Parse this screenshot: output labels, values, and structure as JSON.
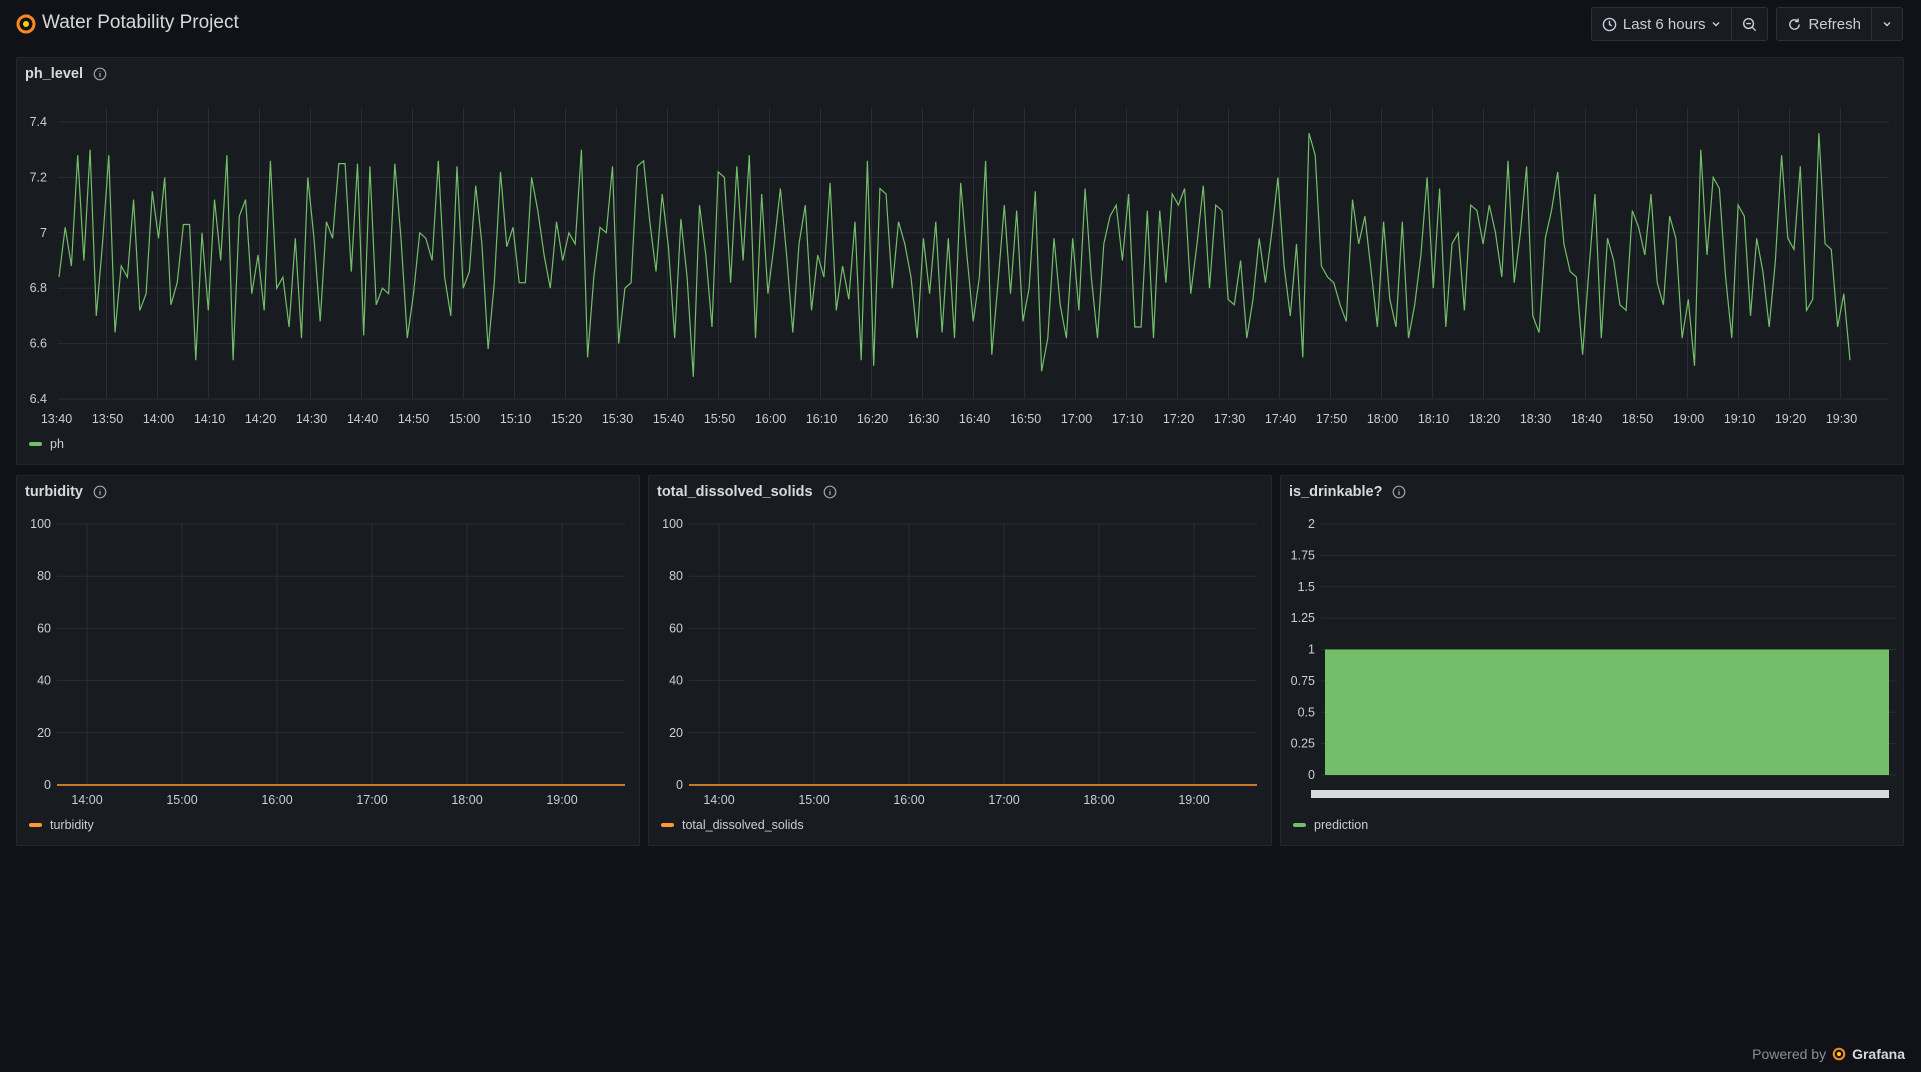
{
  "header": {
    "title": "Water Potability Project",
    "time_range": "Last 6 hours",
    "refresh_label": "Refresh"
  },
  "colors": {
    "green": "#73bf69",
    "orange": "#ff9830"
  },
  "panels": {
    "ph": {
      "title": "ph_level",
      "legend": "ph"
    },
    "turbidity": {
      "title": "turbidity",
      "legend": "turbidity"
    },
    "tds": {
      "title": "total_dissolved_solids",
      "legend": "total_dissolved_solids"
    },
    "drink": {
      "title": "is_drinkable?",
      "legend": "prediction"
    }
  },
  "footer": {
    "powered_by": "Powered by",
    "brand": "Grafana"
  },
  "chart_data": [
    {
      "type": "line",
      "title": "ph_level",
      "series": [
        {
          "name": "ph"
        }
      ],
      "x_ticks": [
        "13:40",
        "13:50",
        "14:00",
        "14:10",
        "14:20",
        "14:30",
        "14:40",
        "14:50",
        "15:00",
        "15:10",
        "15:20",
        "15:30",
        "15:40",
        "15:50",
        "16:00",
        "16:10",
        "16:20",
        "16:30",
        "16:40",
        "16:50",
        "17:00",
        "17:10",
        "17:20",
        "17:30",
        "17:40",
        "17:50",
        "18:00",
        "18:10",
        "18:20",
        "18:30",
        "18:40",
        "18:50",
        "19:00",
        "19:10",
        "19:20",
        "19:30"
      ],
      "y_ticks": [
        "6.4",
        "6.6",
        "6.8",
        "7",
        "7.2",
        "7.4"
      ],
      "ylim": [
        6.4,
        7.4
      ],
      "y": [
        6.84,
        7.02,
        6.88,
        7.28,
        6.9,
        7.3,
        6.7,
        6.96,
        7.28,
        6.64,
        6.88,
        6.84,
        7.12,
        6.72,
        6.78,
        7.15,
        6.98,
        7.2,
        6.74,
        6.82,
        7.03,
        7.03,
        6.54,
        7.0,
        6.72,
        7.12,
        6.9,
        7.28,
        6.54,
        7.06,
        7.12,
        6.78,
        6.92,
        6.72,
        7.26,
        6.8,
        6.84,
        6.66,
        6.98,
        6.62,
        7.2,
        6.98,
        6.68,
        7.04,
        6.98,
        7.25,
        7.25,
        6.86,
        7.25,
        6.63,
        7.24,
        6.74,
        6.8,
        6.78,
        7.25,
        6.98,
        6.62,
        6.78,
        7.0,
        6.98,
        6.9,
        7.26,
        6.84,
        6.7,
        7.24,
        6.8,
        6.86,
        7.17,
        6.96,
        6.58,
        6.82,
        7.22,
        6.95,
        7.02,
        6.82,
        6.82,
        7.2,
        7.08,
        6.92,
        6.8,
        7.04,
        6.9,
        7.0,
        6.96,
        7.3,
        6.55,
        6.84,
        7.02,
        7.0,
        7.24,
        6.6,
        6.8,
        6.82,
        7.24,
        7.26,
        7.04,
        6.86,
        7.14,
        6.95,
        6.62,
        7.05,
        6.84,
        6.48,
        7.1,
        6.92,
        6.66,
        7.22,
        7.2,
        6.82,
        7.24,
        6.9,
        7.28,
        6.62,
        7.14,
        6.78,
        6.96,
        7.16,
        6.92,
        6.64,
        6.96,
        7.1,
        6.72,
        6.92,
        6.84,
        7.18,
        6.72,
        6.88,
        6.76,
        7.04,
        6.54,
        7.26,
        6.52,
        7.16,
        7.14,
        6.8,
        7.04,
        6.96,
        6.84,
        6.62,
        6.98,
        6.78,
        7.04,
        6.64,
        6.98,
        6.62,
        7.18,
        6.92,
        6.68,
        6.84,
        7.26,
        6.56,
        6.82,
        7.1,
        6.78,
        7.08,
        6.68,
        6.8,
        7.15,
        6.5,
        6.62,
        6.98,
        6.74,
        6.62,
        6.98,
        6.72,
        7.16,
        6.84,
        6.62,
        6.96,
        7.06,
        7.1,
        6.9,
        7.14,
        6.66,
        6.66,
        7.08,
        6.62,
        7.08,
        6.82,
        7.14,
        7.1,
        7.16,
        6.78,
        6.96,
        7.17,
        6.8,
        7.1,
        7.08,
        6.76,
        6.74,
        6.9,
        6.62,
        6.76,
        6.98,
        6.82,
        7.0,
        7.2,
        6.88,
        6.7,
        6.96,
        6.55,
        7.36,
        7.28,
        6.88,
        6.84,
        6.82,
        6.74,
        6.68,
        7.12,
        6.96,
        7.06,
        6.86,
        6.66,
        7.04,
        6.76,
        6.66,
        7.04,
        6.62,
        6.74,
        6.92,
        7.2,
        6.8,
        7.16,
        6.66,
        6.96,
        7.0,
        6.72,
        7.1,
        7.08,
        6.96,
        7.1,
        7.0,
        6.84,
        7.26,
        6.82,
        7.0,
        7.24,
        6.7,
        6.64,
        6.98,
        7.08,
        7.22,
        6.96,
        6.86,
        6.84,
        6.56,
        6.86,
        7.14,
        6.62,
        6.98,
        6.9,
        6.74,
        6.72,
        7.08,
        7.02,
        6.92,
        7.14,
        6.82,
        6.74,
        7.06,
        6.98,
        6.62,
        6.76,
        6.52,
        7.3,
        6.92,
        7.2,
        7.16,
        6.84,
        6.62,
        7.1,
        7.06,
        6.7,
        6.98,
        6.86,
        6.66,
        6.9,
        7.28,
        6.98,
        6.94,
        7.24,
        6.72,
        6.76,
        7.36,
        6.96,
        6.94,
        6.66,
        6.78,
        6.54
      ]
    },
    {
      "type": "line",
      "title": "turbidity",
      "series": [
        {
          "name": "turbidity",
          "values": [
            0,
            0
          ]
        }
      ],
      "x": [
        "13:40",
        "19:40"
      ],
      "x_ticks": [
        "14:00",
        "15:00",
        "16:00",
        "17:00",
        "18:00",
        "19:00"
      ],
      "y_ticks": [
        "0",
        "20",
        "40",
        "60",
        "80",
        "100"
      ],
      "ylim": [
        0,
        100
      ]
    },
    {
      "type": "line",
      "title": "total_dissolved_solids",
      "series": [
        {
          "name": "total_dissolved_solids",
          "values": [
            0,
            0
          ]
        }
      ],
      "x": [
        "13:40",
        "19:40"
      ],
      "x_ticks": [
        "14:00",
        "15:00",
        "16:00",
        "17:00",
        "18:00",
        "19:00"
      ],
      "y_ticks": [
        "0",
        "20",
        "40",
        "60",
        "80",
        "100"
      ],
      "ylim": [
        0,
        100
      ]
    },
    {
      "type": "bar",
      "title": "is_drinkable?",
      "series": [
        {
          "name": "prediction",
          "values": [
            1
          ]
        }
      ],
      "y_ticks": [
        "0",
        "0.25",
        "0.5",
        "0.75",
        "1",
        "1.25",
        "1.5",
        "1.75",
        "2"
      ],
      "ylim": [
        0,
        2
      ]
    }
  ]
}
